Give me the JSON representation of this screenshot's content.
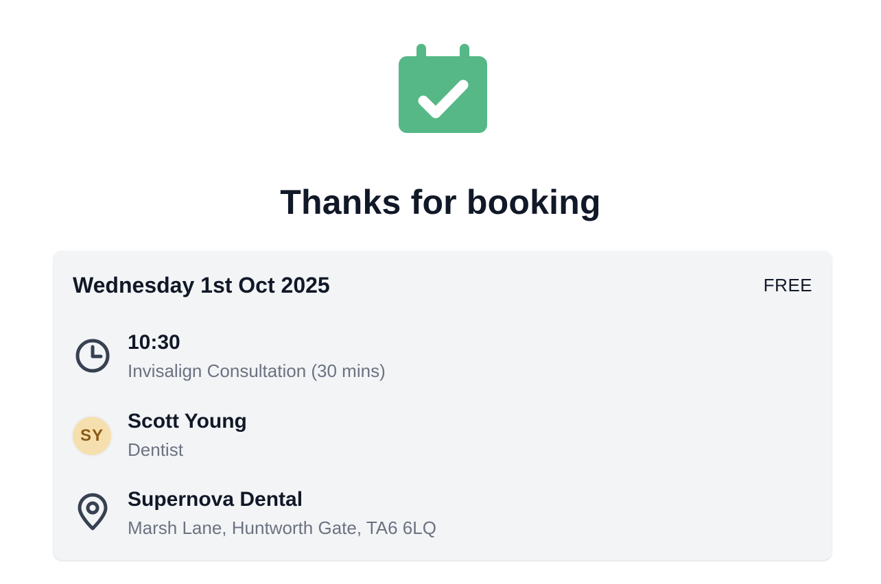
{
  "confirmation": {
    "icon": "calendar-check-icon",
    "title": "Thanks for booking",
    "accent_color": "#55b886"
  },
  "booking": {
    "date": "Wednesday 1st Oct 2025",
    "price": "FREE",
    "time": {
      "icon": "clock-icon",
      "value": "10:30",
      "service": "Invisalign Consultation (30 mins)"
    },
    "practitioner": {
      "initials": "SY",
      "name": "Scott Young",
      "role": "Dentist",
      "avatar_color": "#f6dfae"
    },
    "location": {
      "icon": "map-pin-icon",
      "name": "Supernova Dental",
      "address": "Marsh Lane, Huntworth Gate, TA6 6LQ"
    }
  }
}
